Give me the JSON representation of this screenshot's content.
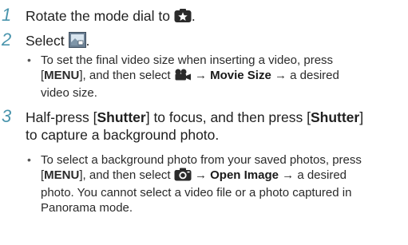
{
  "steps": [
    {
      "number": "1",
      "text": "Rotate the mode dial to",
      "icon": "star-mode-icon",
      "text_end": "."
    },
    {
      "number": "2",
      "text": "Select",
      "icon": "magic-frame-icon",
      "text_end": ".",
      "bullet": {
        "pre": "To set the final video size when inserting a video, press",
        "key_open": "[",
        "key": "MENU",
        "key_close": "], and then select",
        "icon": "movie-camera-icon",
        "arrow1": "→",
        "option": "Movie Size",
        "arrow2": "→",
        "post": "a desired",
        "line3": "video size."
      }
    },
    {
      "number": "3",
      "line1_a": "Half-press [",
      "line1_key1": "Shutter",
      "line1_b": "] to focus, and then press [",
      "line1_key2": "Shutter",
      "line1_c": "]",
      "line2": "to capture a background photo.",
      "bullet": {
        "line1": "To select a background photo from your saved photos, press",
        "key_open": "[",
        "key": "MENU",
        "key_close": "], and then select",
        "icon": "camera-icon",
        "arrow1": "→",
        "option": "Open Image",
        "arrow2": "→",
        "post": "a desired",
        "line3": "photo. You cannot select a video file or a photo captured in",
        "line4": "Panorama mode."
      }
    }
  ],
  "bullet_char": "•"
}
